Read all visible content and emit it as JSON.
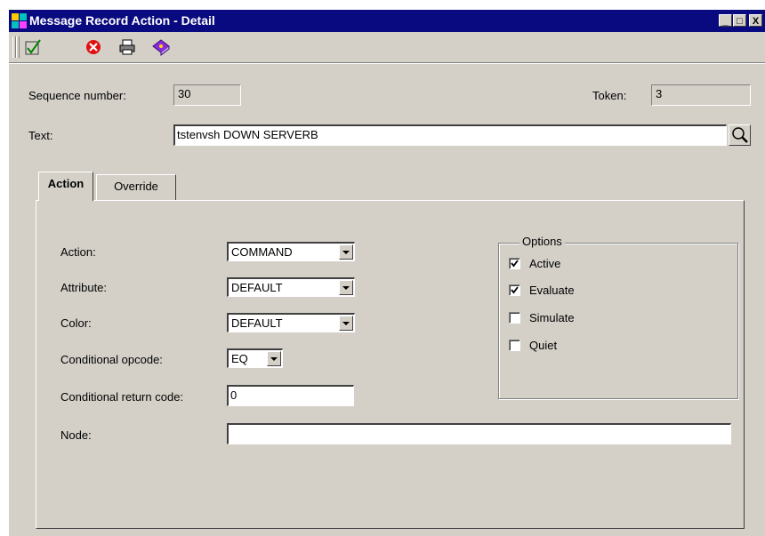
{
  "window": {
    "title": "Message Record Action - Detail"
  },
  "titlebar_buttons": {
    "minimize": "_",
    "maximize": "□",
    "close": "X"
  },
  "toolbar": {
    "icons": [
      "checkmark-icon",
      "cancel-icon",
      "print-icon",
      "book-icon"
    ]
  },
  "sequence": {
    "label": "Sequence number:",
    "value": "30"
  },
  "token": {
    "label": "Token:",
    "value": "3"
  },
  "text": {
    "label": "Text:",
    "value": "tstenvsh DOWN SERVERB"
  },
  "tabs": [
    {
      "label": "Action",
      "active": true
    },
    {
      "label": "Override",
      "active": false
    }
  ],
  "form": {
    "action": {
      "label": "Action:",
      "value": "COMMAND"
    },
    "attribute": {
      "label": "Attribute:",
      "value": "DEFAULT"
    },
    "color": {
      "label": "Color:",
      "value": "DEFAULT"
    },
    "opcode": {
      "label": "Conditional opcode:",
      "value": "EQ"
    },
    "return_code": {
      "label": "Conditional return code:",
      "value": "0"
    },
    "node": {
      "label": "Node:",
      "value": ""
    }
  },
  "options": {
    "title": "Options",
    "items": [
      {
        "label": "Active",
        "checked": true
      },
      {
        "label": "Evaluate",
        "checked": true
      },
      {
        "label": "Simulate",
        "checked": false
      },
      {
        "label": "Quiet",
        "checked": false
      }
    ]
  }
}
